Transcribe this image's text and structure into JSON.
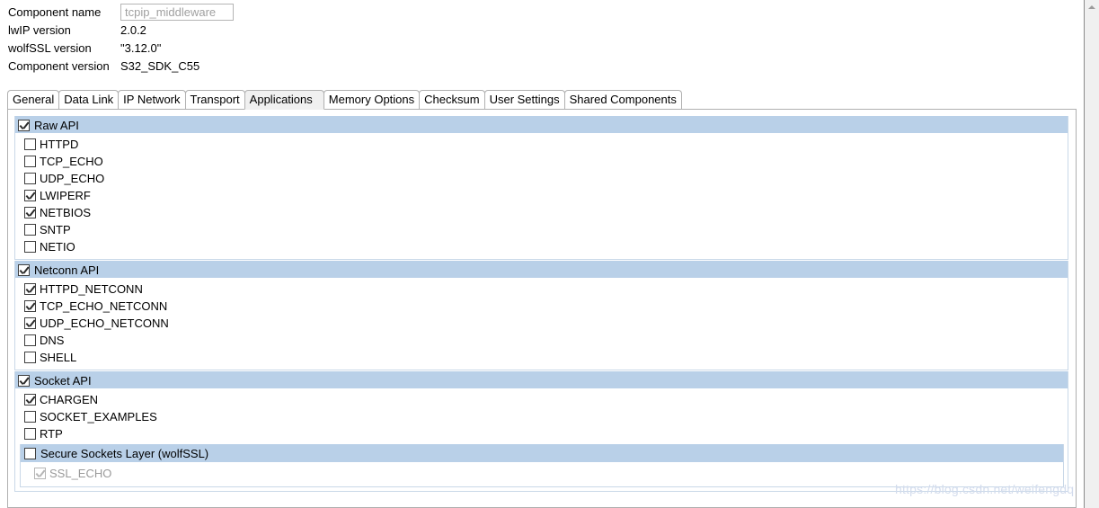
{
  "properties": [
    {
      "label": "Component name",
      "value": "tcpip_middleware",
      "is_input": true,
      "readonly": true
    },
    {
      "label": "lwIP version",
      "value": "2.0.2",
      "is_input": false
    },
    {
      "label": "wolfSSL version",
      "value": "\"3.12.0\"",
      "is_input": false
    },
    {
      "label": "Component version",
      "value": "S32_SDK_C55",
      "is_input": false
    }
  ],
  "tabs": [
    {
      "label": "General",
      "selected": false
    },
    {
      "label": "Data Link",
      "selected": false
    },
    {
      "label": "IP Network",
      "selected": false
    },
    {
      "label": "Transport",
      "selected": false
    },
    {
      "label": "Applications",
      "selected": true
    },
    {
      "label": "Memory Options",
      "selected": false
    },
    {
      "label": "Checksum",
      "selected": false
    },
    {
      "label": "User Settings",
      "selected": false
    },
    {
      "label": "Shared Components",
      "selected": false
    }
  ],
  "groups": [
    {
      "name": "raw-api",
      "header": {
        "label": "Raw API",
        "checked": true,
        "enabled": true
      },
      "items": [
        {
          "label": "HTTPD",
          "checked": false,
          "enabled": true
        },
        {
          "label": "TCP_ECHO",
          "checked": false,
          "enabled": true
        },
        {
          "label": "UDP_ECHO",
          "checked": false,
          "enabled": true
        },
        {
          "label": "LWIPERF",
          "checked": true,
          "enabled": true
        },
        {
          "label": "NETBIOS",
          "checked": true,
          "enabled": true
        },
        {
          "label": "SNTP",
          "checked": false,
          "enabled": true
        },
        {
          "label": "NETIO",
          "checked": false,
          "enabled": true
        }
      ]
    },
    {
      "name": "netconn-api",
      "header": {
        "label": "Netconn API",
        "checked": true,
        "enabled": true
      },
      "items": [
        {
          "label": "HTTPD_NETCONN",
          "checked": true,
          "enabled": true
        },
        {
          "label": "TCP_ECHO_NETCONN",
          "checked": true,
          "enabled": true
        },
        {
          "label": "UDP_ECHO_NETCONN",
          "checked": true,
          "enabled": true
        },
        {
          "label": "DNS",
          "checked": false,
          "enabled": true
        },
        {
          "label": "SHELL",
          "checked": false,
          "enabled": true
        }
      ]
    },
    {
      "name": "socket-api",
      "header": {
        "label": "Socket API",
        "checked": true,
        "enabled": true
      },
      "items": [
        {
          "label": "CHARGEN",
          "checked": true,
          "enabled": true
        },
        {
          "label": "SOCKET_EXAMPLES",
          "checked": false,
          "enabled": true
        },
        {
          "label": "RTP",
          "checked": false,
          "enabled": true
        }
      ],
      "subgroup": {
        "name": "secure-sockets-layer",
        "header": {
          "label": "Secure Sockets Layer (wolfSSL)",
          "checked": false,
          "enabled": true
        },
        "items": [
          {
            "label": "SSL_ECHO",
            "checked": true,
            "enabled": false
          }
        ]
      }
    }
  ],
  "scrollbar": {
    "up_arrow": "chevron-up-icon",
    "position": "top"
  },
  "watermark": {
    "text": "https://blog.csdn.net/weifengdq"
  },
  "colors": {
    "group_header": "#b9d0e8",
    "group_border": "#c9d8e8",
    "panel_border": "#b0b0b0",
    "tab_selected_bg": "#f0f0f0",
    "disabled_text": "#9a9a9a",
    "watermark": "#d3dced"
  }
}
